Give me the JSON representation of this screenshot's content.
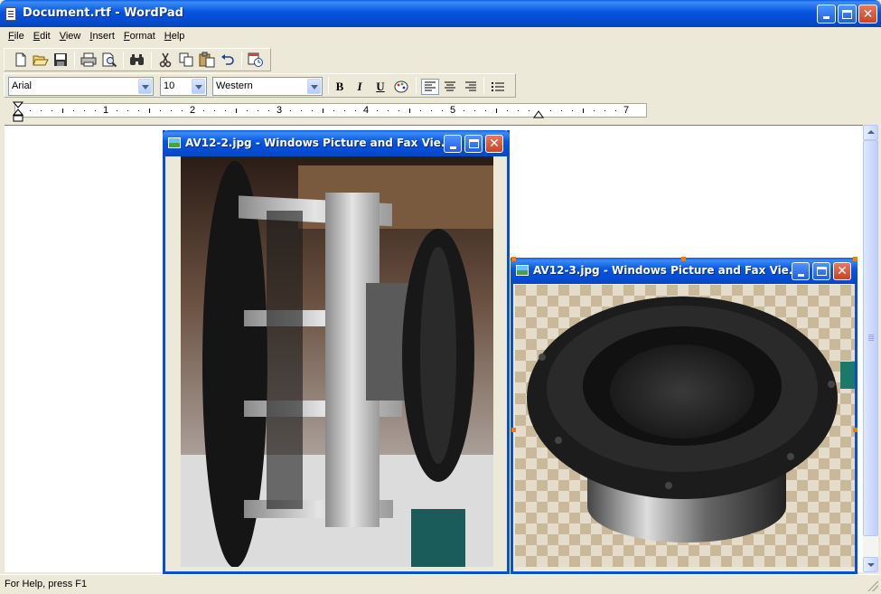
{
  "window": {
    "title": "Document.rtf - WordPad"
  },
  "menu": [
    {
      "label": "File",
      "key": "F",
      "rest": "ile"
    },
    {
      "label": "Edit",
      "key": "E",
      "rest": "dit"
    },
    {
      "label": "View",
      "key": "V",
      "rest": "iew"
    },
    {
      "label": "Insert",
      "key": "I",
      "rest": "nsert"
    },
    {
      "label": "Format",
      "key": "F",
      "rest": "ormat"
    },
    {
      "label": "Help",
      "key": "H",
      "rest": "elp"
    }
  ],
  "toolbar": {
    "buttons": [
      "new-icon",
      "open-icon",
      "save-icon",
      "print-icon",
      "print-preview-icon",
      "find-icon",
      "cut-icon",
      "copy-icon",
      "paste-icon",
      "undo-icon",
      "insert-date-time-icon"
    ]
  },
  "format": {
    "font": "Arial",
    "size": "10",
    "script": "Western",
    "bold": "B",
    "italic": "I",
    "underline": "U"
  },
  "ruler": {
    "numbers": [
      "1",
      "2",
      "3",
      "4",
      "5",
      "7"
    ]
  },
  "viewers": [
    {
      "title": "AV12-2.jpg - Windows Picture and Fax Vie..."
    },
    {
      "title": "AV12-3.jpg - Windows Picture and Fax Vie..."
    }
  ],
  "status": {
    "text": "For Help, press F1"
  },
  "colors": {
    "title_blue": "#0a5de0",
    "close_red": "#c84424",
    "face": "#ece9d8"
  }
}
